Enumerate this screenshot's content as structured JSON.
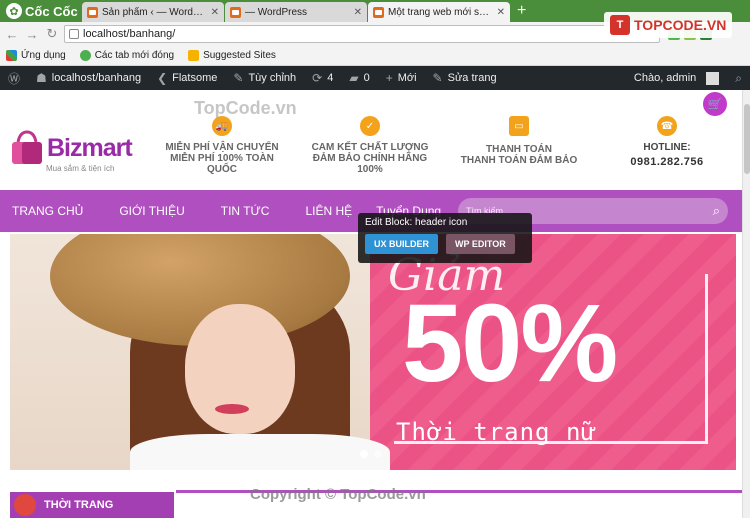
{
  "browser": {
    "brand": "Cốc Cốc",
    "tabs": [
      {
        "title": "Sản phẩm ‹ — WordPress",
        "active": false
      },
      {
        "title": "— WordPress",
        "active": false
      },
      {
        "title": "Một trang web mới sử dụ",
        "active": true
      }
    ],
    "url": "localhost/banhang/",
    "bookmarks": [
      "Ứng dụng",
      "Các tab mới đóng",
      "Suggested Sites"
    ]
  },
  "adminbar": {
    "site": "localhost/banhang",
    "theme": "Flatsome",
    "customize": "Tùy chỉnh",
    "updates": "4",
    "comments": "0",
    "new": "Mới",
    "edit": "Sửa trang",
    "greeting": "Chào, admin"
  },
  "header": {
    "logo": "Bizmart",
    "logo_sub": "Mua sắm & tiện ích",
    "watermark": "TopCode.vn",
    "features": [
      {
        "line1": "MIỄN PHÍ VẬN CHUYỂN",
        "line2": "MIỄN PHÍ 100% TOÀN",
        "line3": "QUỐC"
      },
      {
        "line1": "CAM KẾT CHẤT LƯỢNG",
        "line2": "ĐẢM BẢO CHÍNH HÃNG",
        "line3": "100%"
      },
      {
        "line1": "THANH TOÁN",
        "line2": "THANH TOÁN ĐẢM BẢO",
        "line3": ""
      }
    ],
    "hotline_title": "HOTLINE:",
    "hotline_number": "0981.282.756"
  },
  "nav": {
    "items": [
      "TRANG CHỦ",
      "GIỚI THIỆU",
      "TIN TỨC",
      "LIÊN HỆ",
      "Tuyển Dụng"
    ],
    "search_placeholder": "Tìm kiếm..."
  },
  "edit_tooltip": {
    "title": "Edit Block: header icon",
    "ux_builder": "UX BUILDER",
    "wp_editor": "WP EDITOR"
  },
  "banner": {
    "script": "Giảm",
    "discount": "50%",
    "slogan": "Thời trang nữ"
  },
  "bottom": {
    "category": "THỜI TRANG",
    "copyright": "Copyright © TopCode.vn"
  },
  "topcode_logo": "TOPCODE.VN",
  "colors": {
    "accent": "#b04fbf",
    "banner": "#ef5d8d",
    "browser": "#4a8d3a",
    "adminbar": "#23282d"
  }
}
